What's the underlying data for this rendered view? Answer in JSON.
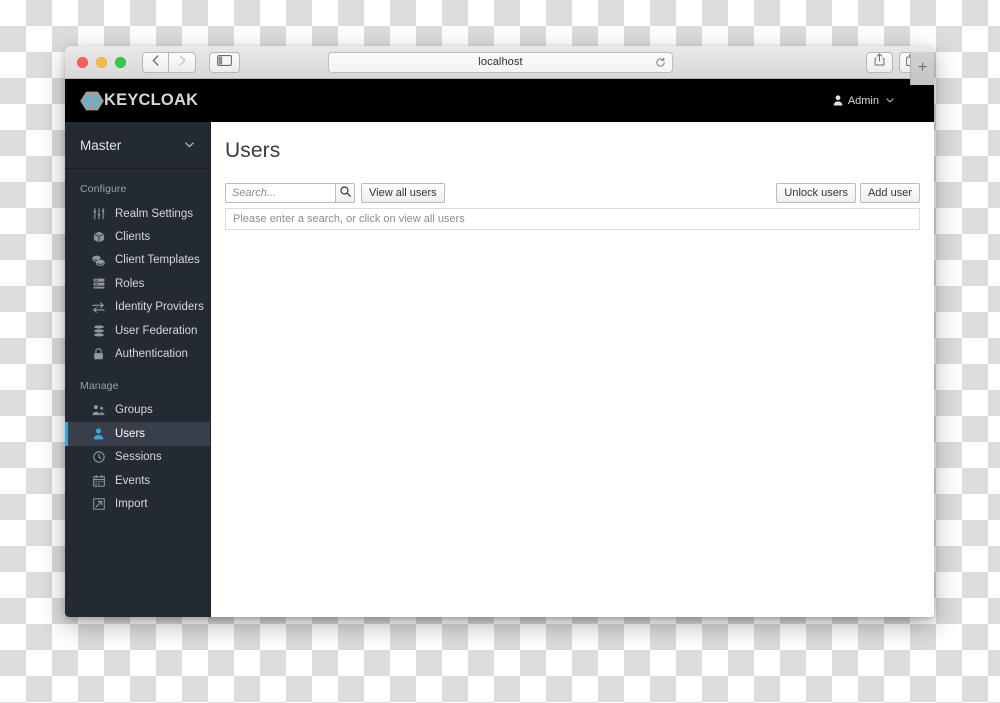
{
  "browser": {
    "address": "localhost",
    "icons": {
      "back": "back-arrow-icon",
      "forward": "forward-arrow-icon",
      "sidebar": "sidebar-toggle-icon",
      "reload": "reload-icon",
      "share": "share-icon",
      "tabs": "tab-overview-icon",
      "newtab": "+"
    }
  },
  "header": {
    "logo_text": "KEYCLOAK",
    "user_label": "Admin",
    "caret": "⌄"
  },
  "sidebar": {
    "realm": "Master",
    "realm_caret": "⌄",
    "sections": [
      {
        "label": "Configure",
        "items": [
          {
            "label": "Realm Settings",
            "icon": "sliders-icon",
            "active": false
          },
          {
            "label": "Clients",
            "icon": "cube-icon",
            "active": false
          },
          {
            "label": "Client Templates",
            "icon": "coins-icon",
            "active": false
          },
          {
            "label": "Roles",
            "icon": "layers-icon",
            "active": false
          },
          {
            "label": "Identity Providers",
            "icon": "exchange-arrows-icon",
            "active": false
          },
          {
            "label": "User Federation",
            "icon": "database-icon",
            "active": false
          },
          {
            "label": "Authentication",
            "icon": "lock-icon",
            "active": false
          }
        ]
      },
      {
        "label": "Manage",
        "items": [
          {
            "label": "Groups",
            "icon": "users-group-icon",
            "active": false
          },
          {
            "label": "Users",
            "icon": "user-icon",
            "active": true
          },
          {
            "label": "Sessions",
            "icon": "clock-icon",
            "active": false
          },
          {
            "label": "Events",
            "icon": "calendar-icon",
            "active": false
          },
          {
            "label": "Import",
            "icon": "import-arrow-icon",
            "active": false
          }
        ]
      }
    ]
  },
  "main": {
    "title": "Users",
    "search": {
      "placeholder": "Search...",
      "value": "",
      "icon": "search-icon"
    },
    "view_all_label": "View all users",
    "unlock_users_label": "Unlock users",
    "add_user_label": "Add user",
    "info_message": "Please enter a search, or click on view all users"
  },
  "colors": {
    "accent": "#39a5dc",
    "sidebar_bg": "#242a32",
    "sidebar_active_bg": "#383f4a",
    "header_bg": "#000000",
    "logo_text": "#d6d6d6"
  }
}
